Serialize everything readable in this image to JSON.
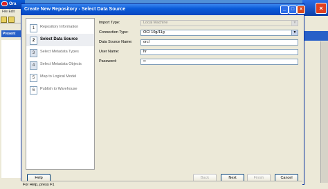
{
  "background_app": {
    "title": "Ora",
    "menu": "File  Edit",
    "panel_header": "Present"
  },
  "dialog": {
    "title": "Create New Repository - Select Data Source",
    "steps": [
      {
        "number": "1",
        "label": "Repository Information",
        "state": "done"
      },
      {
        "number": "2",
        "label": "Select Data Source",
        "state": "active"
      },
      {
        "number": "3",
        "label": "Select Metadata Types",
        "state": "future"
      },
      {
        "number": "4",
        "label": "Select Metadata Objects",
        "state": "future"
      },
      {
        "number": "5",
        "label": "Map to Logical Model",
        "state": "done"
      },
      {
        "number": "6",
        "label": "Publish to Warehouse",
        "state": "done"
      }
    ],
    "form": {
      "import_type": {
        "label": "Import Type:",
        "value": "Local Machine"
      },
      "connection_type": {
        "label": "Connection Type:",
        "value": "OCI 10g/11g"
      },
      "data_source_name": {
        "label": "Data Source Name:",
        "value": "orcl"
      },
      "user_name": {
        "label": "User Name:",
        "value": "hr"
      },
      "password": {
        "label": "Password:",
        "value": "••"
      }
    },
    "buttons": {
      "help": "Help",
      "back": "Back",
      "next": "Next",
      "finish": "Finish",
      "cancel": "Cancel"
    }
  },
  "status_bar": {
    "text": "For Help, press F1"
  }
}
